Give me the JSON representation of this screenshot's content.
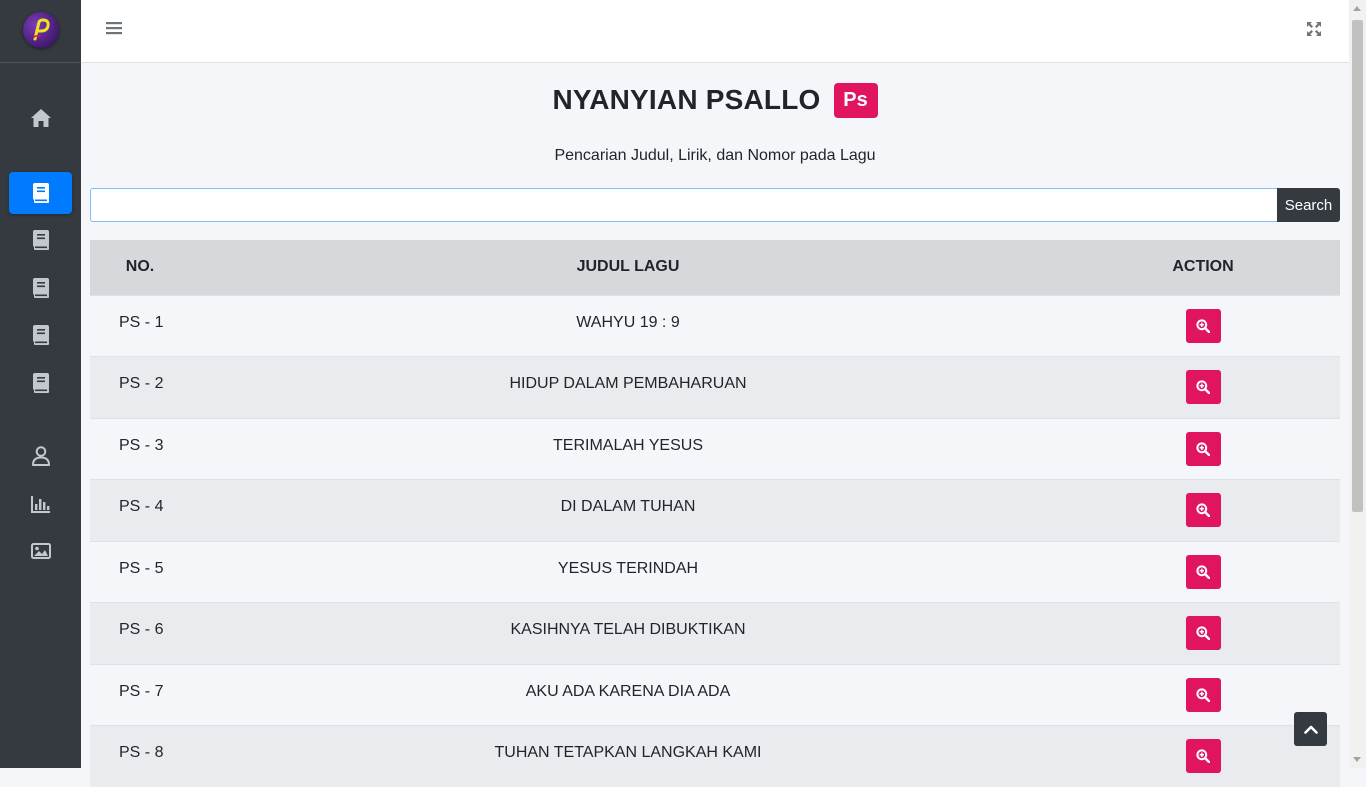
{
  "app": {
    "brand_logo_letter": "P",
    "accent_color": "#007bff",
    "brand_color": "#e0145f"
  },
  "sidebar": {
    "items": [
      {
        "icon": "home-icon"
      },
      {
        "icon": "book-icon",
        "active": true
      },
      {
        "icon": "book-icon"
      },
      {
        "icon": "book-icon"
      },
      {
        "icon": "book-icon"
      },
      {
        "icon": "book-icon"
      },
      {
        "icon": "user-icon"
      },
      {
        "icon": "chart-bar-icon"
      },
      {
        "icon": "image-icon"
      }
    ]
  },
  "header": {
    "menu_icon": "hamburger-icon",
    "fullscreen_icon": "expand-icon"
  },
  "main": {
    "title": "NYANYIAN PSALLO",
    "badge": "Ps",
    "subtitle": "Pencarian Judul, Lirik, dan Nomor pada Lagu",
    "search": {
      "value": "",
      "placeholder": "",
      "button_label": "Search"
    },
    "table": {
      "headers": [
        "NO.",
        "JUDUL LAGU",
        "ACTION"
      ],
      "rows": [
        {
          "no": "PS - 1",
          "title": "WAHYU 19 : 9"
        },
        {
          "no": "PS - 2",
          "title": "HIDUP DALAM PEMBAHARUAN"
        },
        {
          "no": "PS - 3",
          "title": "TERIMALAH YESUS"
        },
        {
          "no": "PS - 4",
          "title": "DI DALAM TUHAN"
        },
        {
          "no": "PS - 5",
          "title": "YESUS TERINDAH"
        },
        {
          "no": "PS - 6",
          "title": "KASIHNYA TELAH DIBUKTIKAN"
        },
        {
          "no": "PS - 7",
          "title": "AKU ADA KARENA DIA ADA"
        },
        {
          "no": "PS - 8",
          "title": "TUHAN TETAPKAN LANGKAH KAMI"
        }
      ]
    }
  },
  "back_to_top_icon": "chevron-up-icon"
}
